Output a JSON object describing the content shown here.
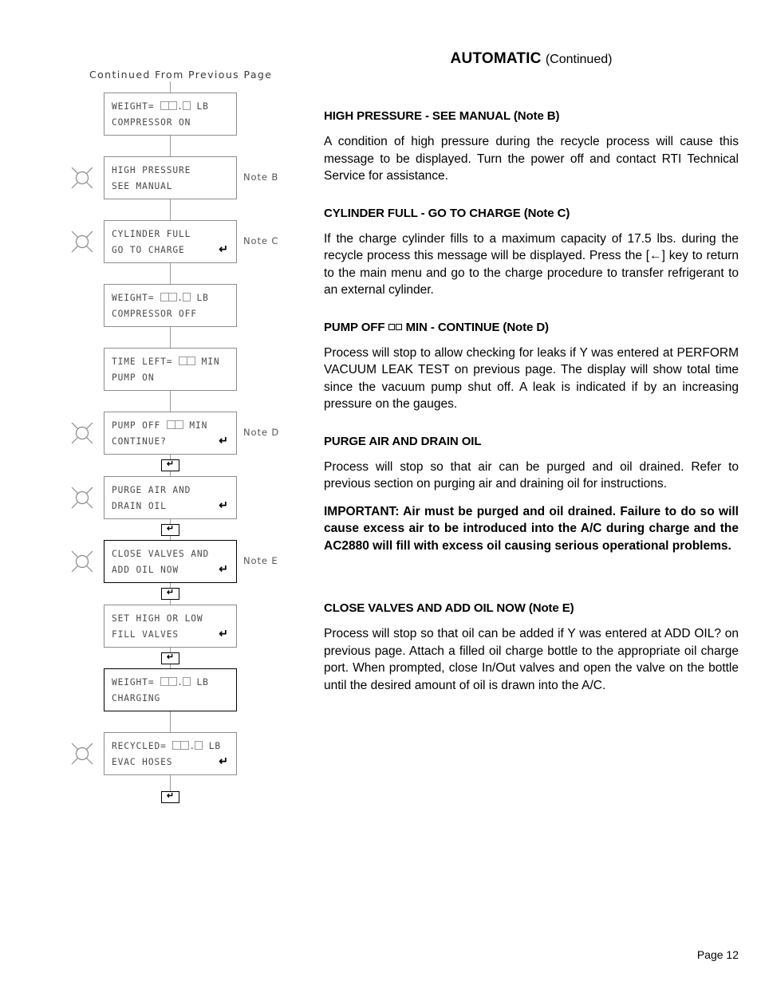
{
  "header": {
    "title_main": "AUTOMATIC",
    "title_sub": "(Continued)"
  },
  "footer": {
    "page_label": "Page 12"
  },
  "flowchart": {
    "top_label": "Continued From Previous Page",
    "boxes": [
      {
        "id": "weight-compressor-on",
        "line1_pre": "WEIGHT=",
        "line1_post": "LB",
        "line2": "COMPRESSOR ON",
        "squares": "dd",
        "enter": false,
        "burst": false,
        "note": "",
        "strong": false
      },
      {
        "id": "high-pressure",
        "line1_pre": "HIGH PRESSURE",
        "line1_post": "",
        "line2": "SEE MANUAL",
        "squares": "",
        "enter": false,
        "burst": true,
        "note": "Note B",
        "strong": false
      },
      {
        "id": "cylinder-full",
        "line1_pre": "CYLINDER FULL",
        "line1_post": "",
        "line2": "GO TO CHARGE",
        "squares": "",
        "enter": true,
        "burst": true,
        "note": "Note C",
        "strong": false
      },
      {
        "id": "weight-compressor-off",
        "line1_pre": "WEIGHT=",
        "line1_post": "LB",
        "line2": "COMPRESSOR OFF",
        "squares": "dd",
        "enter": false,
        "burst": false,
        "note": "",
        "strong": false
      },
      {
        "id": "time-left-pump-on",
        "line1_pre": "TIME LEFT=",
        "line1_post": "MIN",
        "line2": "PUMP ON",
        "squares": "d2",
        "enter": false,
        "burst": false,
        "note": "",
        "strong": false
      },
      {
        "id": "pump-off-continue",
        "line1_pre": "PUMP OFF",
        "line1_post": "MIN",
        "line2": "CONTINUE?",
        "squares": "d2",
        "enter": true,
        "burst": true,
        "note": "Note D",
        "strong": false
      },
      {
        "id": "purge-air-drain-oil",
        "line1_pre": "PURGE AIR AND",
        "line1_post": "",
        "line2": "DRAIN OIL",
        "squares": "",
        "enter": true,
        "burst": true,
        "note": "",
        "strong": false
      },
      {
        "id": "close-valves-add-oil",
        "line1_pre": "CLOSE VALVES AND",
        "line1_post": "",
        "line2": "ADD OIL NOW",
        "squares": "",
        "enter": true,
        "burst": true,
        "note": "Note E",
        "strong": true
      },
      {
        "id": "set-fill-valves",
        "line1_pre": "SET HIGH OR LOW",
        "line1_post": "",
        "line2": "FILL VALVES",
        "squares": "",
        "enter": true,
        "burst": false,
        "note": "",
        "strong": false
      },
      {
        "id": "weight-charging",
        "line1_pre": "WEIGHT=",
        "line1_post": "LB",
        "line2": "CHARGING",
        "squares": "dd",
        "enter": false,
        "burst": false,
        "note": "",
        "strong": true
      },
      {
        "id": "recycled-evac-hoses",
        "line1_pre": "RECYCLED=",
        "line1_post": "LB",
        "line2": "EVAC HOSES",
        "squares": "dd",
        "enter": true,
        "burst": true,
        "note": "",
        "strong": false
      }
    ],
    "enter_glyph": "↵"
  },
  "sections": [
    {
      "id": "high-pressure",
      "heading": "HIGH PRESSURE - SEE MANUAL (Note B)",
      "body": "A condition of high pressure during the recycle process will cause this message to be displayed. Turn the power off and contact RTI Technical Service for assistance."
    },
    {
      "id": "cylinder-full",
      "heading": "CYLINDER FULL - GO TO CHARGE (Note C)",
      "body": "If the charge cylinder fills to a maximum capacity of 17.5 lbs. during the recycle process this message will be displayed. Press the [←] key to return to the main menu and go to the charge procedure to transfer refrigerant to an external cylinder."
    },
    {
      "id": "pump-off",
      "heading_pre": "PUMP OFF",
      "heading_post": "MIN - CONTINUE (Note D)",
      "body": "Process will stop to allow checking for leaks if Y was entered at PERFORM VACUUM LEAK TEST on previous page. The display will show total time since the vacuum pump shut off. A leak is indicated if by an increasing pressure on the gauges."
    },
    {
      "id": "purge-air",
      "heading": "PURGE AIR AND DRAIN OIL",
      "body": "Process will stop so that air can be purged and oil drained. Refer to previous section on purging air and draining oil for instructions.",
      "body_bold": "IMPORTANT: Air must be purged and oil drained. Failure to do so will cause excess air to be introduced into the A/C during charge and the AC2880 will fill with excess oil causing serious operational problems."
    },
    {
      "id": "close-valves",
      "heading": "CLOSE VALVES AND ADD OIL NOW (Note E)",
      "body": "Process will stop so that oil can be added if Y was entered at ADD OIL? on previous page. Attach a filled oil charge bottle to the appropriate oil charge port. When prompted, close In/Out valves and open the valve on the bottle until the desired amount of oil is drawn into the A/C."
    }
  ]
}
